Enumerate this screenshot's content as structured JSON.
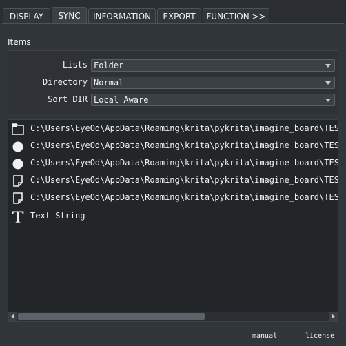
{
  "tabs": [
    {
      "label": "DISPLAY"
    },
    {
      "label": "SYNC"
    },
    {
      "label": "INFORMATION"
    },
    {
      "label": "EXPORT"
    },
    {
      "label": "FUNCTION >>"
    }
  ],
  "items_section": {
    "title": "Items",
    "rows": [
      {
        "label": "Lists",
        "value": "Folder"
      },
      {
        "label": "Directory",
        "value": "Normal"
      },
      {
        "label": "Sort DIR",
        "value": "Local Aware"
      }
    ]
  },
  "list": {
    "entries": [
      {
        "icon": "folder-icon",
        "text": "C:\\Users\\EyeOd\\AppData\\Roaming\\krita\\pykrita\\imagine_board\\TEST"
      },
      {
        "icon": "circle-icon",
        "text": "C:\\Users\\EyeOd\\AppData\\Roaming\\krita\\pykrita\\imagine_board\\TEST"
      },
      {
        "icon": "circle-icon",
        "text": "C:\\Users\\EyeOd\\AppData\\Roaming\\krita\\pykrita\\imagine_board\\TEST"
      },
      {
        "icon": "file-icon",
        "text": "C:\\Users\\EyeOd\\AppData\\Roaming\\krita\\pykrita\\imagine_board\\TEST"
      },
      {
        "icon": "file-icon",
        "text": "C:\\Users\\EyeOd\\AppData\\Roaming\\krita\\pykrita\\imagine_board\\TEST"
      },
      {
        "icon": "text-icon",
        "text": "Text String"
      }
    ]
  },
  "footer": {
    "manual": "manual",
    "license": "license"
  },
  "colors": {
    "background": "#31363b",
    "list_background": "#232629",
    "text": "#eff0f1"
  }
}
